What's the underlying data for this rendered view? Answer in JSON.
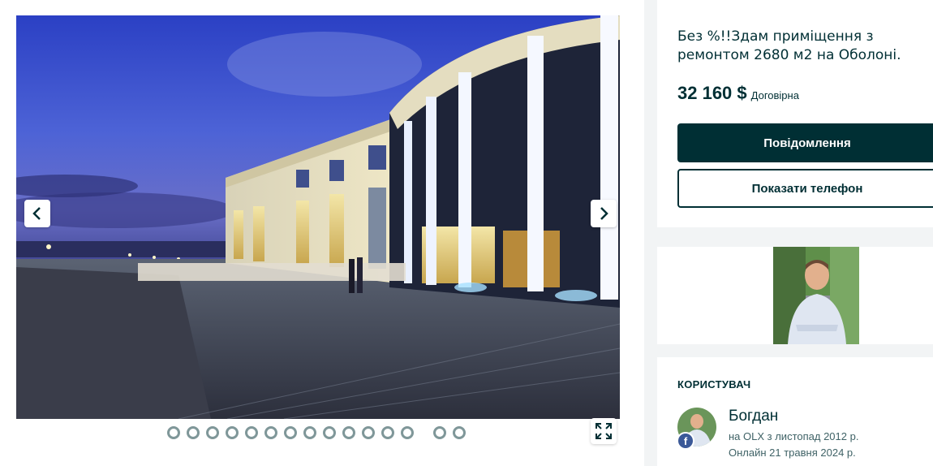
{
  "gallery": {
    "prev_icon": "chevron-left-icon",
    "next_icon": "chevron-right-icon",
    "fullscreen_icon": "expand-icon",
    "dot_count": 15
  },
  "ad": {
    "title": "Без %!!Здам приміщення з ремонтом 2680 м2 на Оболоні.",
    "price": "32 160 $",
    "negotiable": "Договірна",
    "message_button": "Повідомлення",
    "phone_button": "Показати телефон"
  },
  "user": {
    "heading": "КОРИСТУВАЧ",
    "name": "Богдан",
    "since": "на OLX з листопад 2012 р.",
    "online": "Онлайн 21 травня 2024 р.",
    "badge_icon": "facebook-icon"
  },
  "colors": {
    "primary": "#002f34",
    "secondary_text": "#406367",
    "background": "#f2f4f5",
    "dot_border": "#7f9799",
    "facebook": "#3b5998"
  }
}
